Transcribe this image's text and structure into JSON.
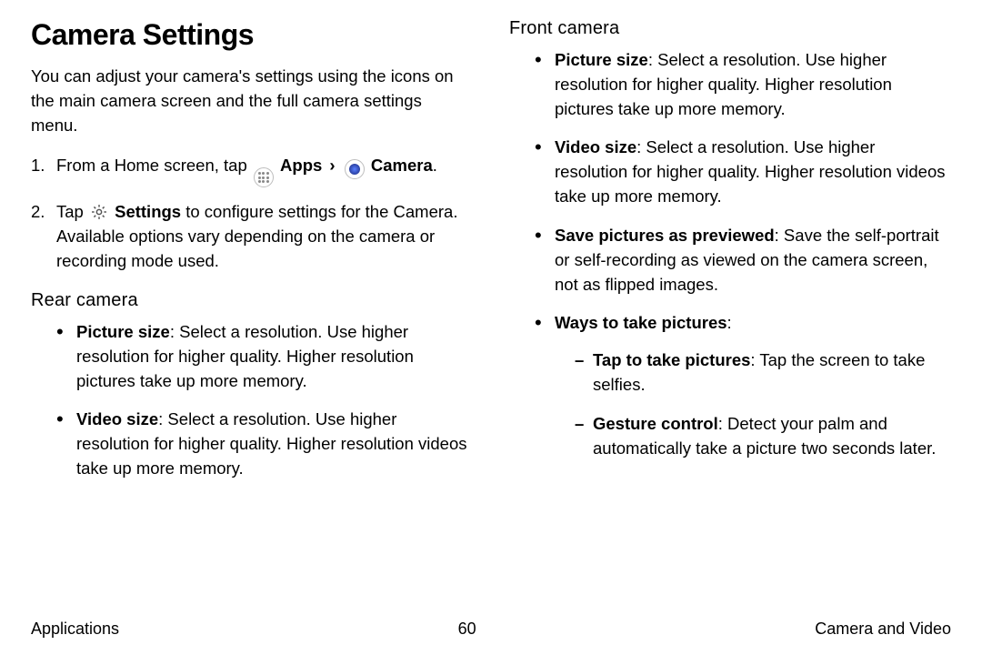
{
  "title": "Camera Settings",
  "intro": "You can adjust your camera's settings using the icons on the main camera screen and the full camera settings menu.",
  "step1": {
    "pre": "From a Home screen, tap ",
    "apps": "Apps",
    "chev": "›",
    "camera": "Camera",
    "suffix": "."
  },
  "step2": {
    "pre": "Tap ",
    "settings": "Settings",
    "rest": " to configure settings for the Camera. Available options vary depending on the camera or recording mode used."
  },
  "rear": {
    "heading": "Rear camera",
    "items": [
      {
        "bold": "Picture size",
        "text": ": Select a resolution. Use higher resolution for higher quality. Higher resolution pictures take up more memory."
      },
      {
        "bold": "Video size",
        "text": ": Select a resolution. Use higher resolution for higher quality. Higher resolution videos take up more memory."
      }
    ]
  },
  "front": {
    "heading": "Front camera",
    "items": [
      {
        "bold": "Picture size",
        "text": ": Select a resolution. Use higher resolution for higher quality. Higher resolution pictures take up more memory."
      },
      {
        "bold": "Video size",
        "text": ": Select a resolution. Use higher resolution for higher quality. Higher resolution videos take up more memory."
      },
      {
        "bold": "Save pictures as previewed",
        "text": ": Save the self-portrait or self-recording as viewed on the camera screen, not as flipped images."
      },
      {
        "bold": "Ways to take pictures",
        "text": ":"
      }
    ],
    "ways": [
      {
        "bold": "Tap to take pictures",
        "text": ": Tap the screen to take selfies."
      },
      {
        "bold": "Gesture control",
        "text": ": Detect your palm and automatically take a picture two seconds later."
      }
    ]
  },
  "footer": {
    "left": "Applications",
    "center": "60",
    "right": "Camera and Video"
  }
}
